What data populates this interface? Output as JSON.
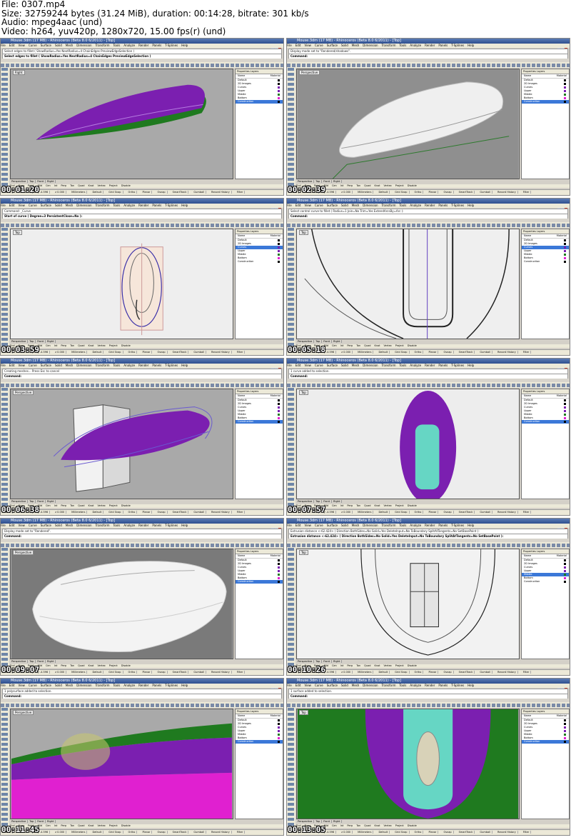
{
  "info": {
    "line1": "File: 0307.mp4",
    "line2": "Size: 32759244 bytes (31.24 MiB), duration: 00:14:28, bitrate: 301 kb/s",
    "line3": "Audio: mpeg4aac (und)",
    "line4": "Video: h264, yuv420p, 1280x720, 15.00 fps(r) (und)"
  },
  "app": {
    "title": "Mouse.3dm (17 MB) - Rhinoceros (Beta 8.0 6/2011) - [Top]",
    "menu": [
      "File",
      "Edit",
      "View",
      "Curve",
      "Surface",
      "Solid",
      "Mesh",
      "Dimension",
      "Transform",
      "Tools",
      "Analyze",
      "Render",
      "Panels",
      "T-Splines",
      "Help"
    ],
    "tabs": [
      "Standard",
      "CPlanes",
      "Set View",
      "Display",
      "Select",
      "Viewport Layout",
      "Visibility",
      "Transform",
      "Curve Tools",
      "Surface Tools",
      "Solid Tools",
      "Mesh Tools",
      "Render Tools",
      "Drafting",
      "New in V5"
    ],
    "viewport_tabs": [
      "Perspective",
      "Top",
      "Front",
      "Right"
    ],
    "osnaps": [
      "End",
      "Near",
      "Point",
      "Mid",
      "Cen",
      "Int",
      "Perp",
      "Tan",
      "Quad",
      "Knot",
      "Vertex",
      "Project",
      "Disable"
    ],
    "status": [
      "CPlane",
      "x 117.024",
      "y -4.596",
      "z 0.000",
      "Millimeters",
      "Default",
      "Grid Snap",
      "Ortho",
      "Planar",
      "Osnap",
      "SmartTrack",
      "Gumball",
      "Record History",
      "Filter"
    ],
    "panel_tabs": "Properties  Layers",
    "layer_header": [
      "Name",
      "Material"
    ],
    "layers": [
      "Default",
      "2D Images",
      "Curves",
      "Upper",
      "Middle",
      "Bottom",
      "Construction"
    ]
  },
  "colors": {
    "purple": "#7b1fb0",
    "green": "#1f7a1f",
    "magenta": "#e020d0",
    "teal": "#66d6c4",
    "viewport_gray": "#a9a9a9",
    "selection_blue": "#3b78d8"
  },
  "frames": [
    {
      "timestamp": "00:01:20",
      "history": "Select edges to fillet ( ShowRadius=Yes  NextRadius=4  ChainEdges  PreviewEdgeSelection )",
      "command": "Select edges to fillet ( ShowRadius=Yes NextRadius=4 ChainEdges PreviewEdgeSelection )",
      "viewport": "Right",
      "active_layer": 6
    },
    {
      "timestamp": "00:02:39",
      "history": "Display mode set to \"Rendered/shadows\".",
      "command": "Command:",
      "viewport": "Perspective",
      "active_layer": 6
    },
    {
      "timestamp": "00:03:59",
      "history": "Command: _Curve",
      "command": "Start of curve ( Degree=3  PersistentClose=No ):",
      "viewport": "Top",
      "active_layer": 2
    },
    {
      "timestamp": "00:05:18",
      "history": "Select control curve to fillet ( Radius=1  Join=No  Trim=Yes  ExtendArcsBy=Arc ):",
      "command": "Command:",
      "viewport": "Top",
      "active_layer": 2
    },
    {
      "timestamp": "00:06:38",
      "history": "Creating meshes... Press Esc to cancel",
      "command": "Command:",
      "viewport": "Perspective",
      "active_layer": 6
    },
    {
      "timestamp": "00:07:57",
      "history": "1 curve added to selection.",
      "command": "Command:",
      "viewport": "Top",
      "active_layer": 6
    },
    {
      "timestamp": "00:09:07",
      "history": "Display mode set to \"Rendered\".",
      "command": "Command:",
      "viewport": "Perspective",
      "active_layer": 6
    },
    {
      "timestamp": "00:10:26",
      "history": "Extrusion distance <-62.424> ( Direction  BothSides=No  Solid=Yes  DeleteInput=No  ToBoundary  SplitAtTangents=No  SetBasePoint ):",
      "command": "Extrusion distance <-62.424> ( Direction BothSides=No Solid=Yes DeleteInput=No ToBoundary SplitAtTangents=No SetBasePoint ):",
      "viewport": "Top",
      "active_layer": 4
    },
    {
      "timestamp": "00:11:45",
      "history": "1 polysurface added to selection.",
      "command": "Command:",
      "viewport": "Perspective",
      "active_layer": 6
    },
    {
      "timestamp": "00:13:05",
      "history": "1 surface added to selection.",
      "command": "Command:",
      "viewport": "Top",
      "active_layer": 6
    }
  ]
}
